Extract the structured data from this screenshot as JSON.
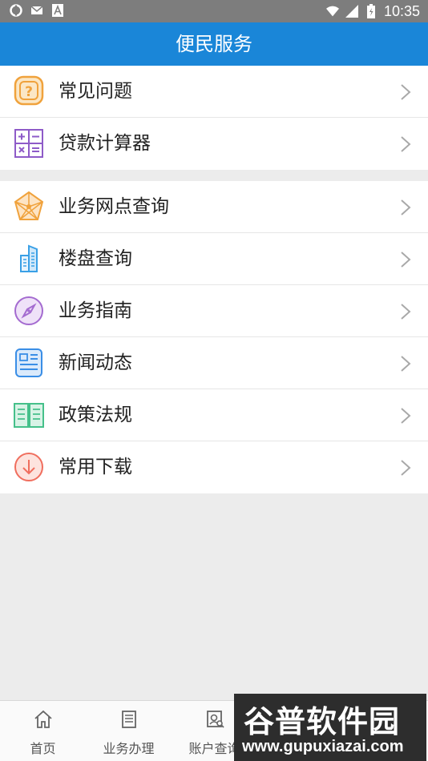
{
  "status_bar": {
    "time": "10:35"
  },
  "header": {
    "title": "便民服务"
  },
  "menu_group_1": [
    {
      "label": "常见问题",
      "icon": "question-icon",
      "color": "#f0a23c"
    },
    {
      "label": "贷款计算器",
      "icon": "calculator-icon",
      "color": "#8e5bc8"
    }
  ],
  "menu_group_2": [
    {
      "label": "业务网点查询",
      "icon": "network-icon",
      "color": "#f0a23c"
    },
    {
      "label": "楼盘查询",
      "icon": "building-icon",
      "color": "#3aa0e6"
    },
    {
      "label": "业务指南",
      "icon": "compass-icon",
      "color": "#a46bd0"
    },
    {
      "label": "新闻动态",
      "icon": "news-icon",
      "color": "#3a8ee6"
    },
    {
      "label": "政策法规",
      "icon": "book-icon",
      "color": "#45c08a"
    },
    {
      "label": "常用下载",
      "icon": "download-icon",
      "color": "#f06e5e"
    }
  ],
  "tab_bar": {
    "tabs": [
      {
        "label": "首页",
        "icon": "home-icon"
      },
      {
        "label": "业务办理",
        "icon": "document-icon"
      },
      {
        "label": "账户查询",
        "icon": "account-search-icon"
      }
    ]
  },
  "watermark": {
    "title": "谷普软件园",
    "url": "www.gupuxiazai.com"
  }
}
